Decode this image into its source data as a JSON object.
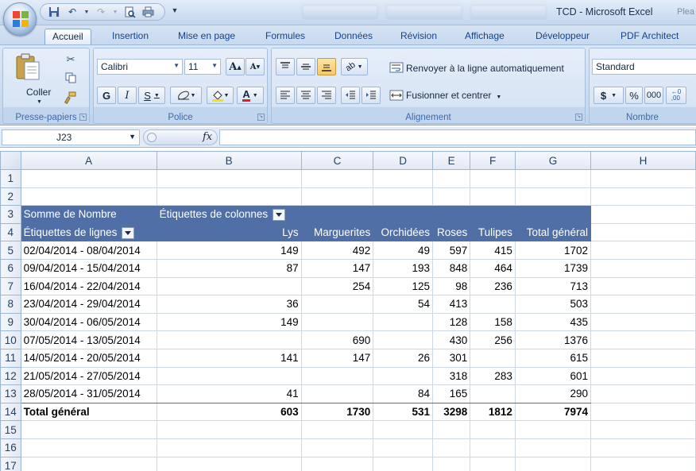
{
  "window": {
    "title": "TCD - Microsoft Excel",
    "title_extra": "Plea"
  },
  "ribbon_tabs": [
    "Accueil",
    "Insertion",
    "Mise en page",
    "Formules",
    "Données",
    "Révision",
    "Affichage",
    "Développeur",
    "PDF Architect"
  ],
  "clipboard": {
    "paste_label": "Coller",
    "group_label": "Presse-papiers"
  },
  "font": {
    "family": "Calibri",
    "size": "11",
    "bold": "G",
    "italic": "I",
    "underline": "S",
    "grow": "A",
    "shrink": "A",
    "color_letter": "A",
    "group_label": "Police"
  },
  "alignment": {
    "wrap_label": "Renvoyer à la ligne automatiquement",
    "merge_label": "Fusionner et centrer",
    "group_label": "Alignement"
  },
  "number": {
    "format": "Standard",
    "currency": "$",
    "percent": "%",
    "thousands": "000",
    "group_label": "Nombre"
  },
  "formula_bar": {
    "cell_ref": "J23",
    "fx": "fx",
    "content": ""
  },
  "columns": [
    "A",
    "B",
    "C",
    "D",
    "E",
    "F",
    "G",
    "H"
  ],
  "row_numbers": [
    "1",
    "2",
    "3",
    "4",
    "5",
    "6",
    "7",
    "8",
    "9",
    "10",
    "11",
    "12",
    "13",
    "14",
    "15",
    "16",
    "17"
  ],
  "pivot": {
    "values_label": "Somme de Nombre",
    "columns_label": "Étiquettes de colonnes",
    "rows_label": "Étiquettes de lignes",
    "headers": [
      "Lys",
      "Marguerites",
      "Orchidées",
      "Roses",
      "Tulipes",
      "Total général"
    ],
    "rows": [
      {
        "label": "02/04/2014 - 08/04/2014",
        "values": [
          "149",
          "492",
          "49",
          "597",
          "415",
          "1702"
        ]
      },
      {
        "label": "09/04/2014 - 15/04/2014",
        "values": [
          "87",
          "147",
          "193",
          "848",
          "464",
          "1739"
        ]
      },
      {
        "label": "16/04/2014 - 22/04/2014",
        "values": [
          "",
          "254",
          "125",
          "98",
          "236",
          "713"
        ]
      },
      {
        "label": "23/04/2014 - 29/04/2014",
        "values": [
          "36",
          "",
          "54",
          "413",
          "",
          "503"
        ]
      },
      {
        "label": "30/04/2014 - 06/05/2014",
        "values": [
          "149",
          "",
          "",
          "128",
          "158",
          "435"
        ]
      },
      {
        "label": "07/05/2014 - 13/05/2014",
        "values": [
          "",
          "690",
          "",
          "430",
          "256",
          "1376"
        ]
      },
      {
        "label": "14/05/2014 - 20/05/2014",
        "values": [
          "141",
          "147",
          "26",
          "301",
          "",
          "615"
        ]
      },
      {
        "label": "21/05/2014 - 27/05/2014",
        "values": [
          "",
          "",
          "",
          "318",
          "283",
          "601"
        ]
      },
      {
        "label": "28/05/2014 - 31/05/2014",
        "values": [
          "41",
          "",
          "84",
          "165",
          "",
          "290"
        ]
      }
    ],
    "total": {
      "label": "Total général",
      "values": [
        "603",
        "1730",
        "531",
        "3298",
        "1812",
        "7974"
      ]
    }
  },
  "colors": {
    "pivot_header": "#4f6fa6",
    "ribbon": "#c9daf0",
    "tab_text": "#15428b"
  }
}
